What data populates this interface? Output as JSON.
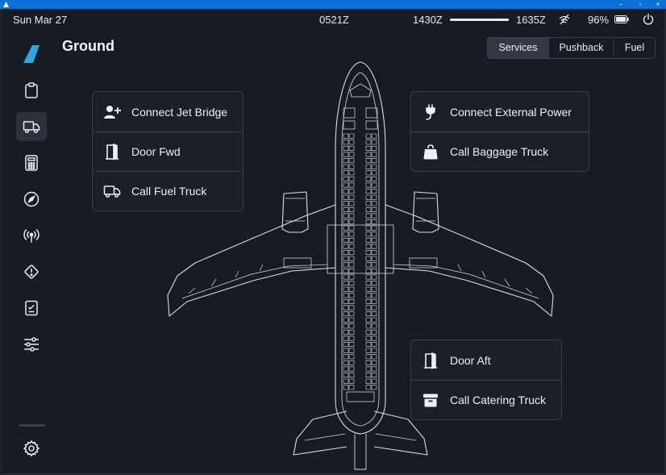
{
  "status_bar": {
    "date": "Sun Mar 27",
    "zulu_time": "0521Z",
    "flight_start": "1430Z",
    "flight_end": "1635Z",
    "flight_progress_fraction": 1.0,
    "battery_percent": "96%"
  },
  "sidebar": {
    "items": [
      {
        "name": "clipboard-icon",
        "active": false
      },
      {
        "name": "truck-icon",
        "active": true
      },
      {
        "name": "calculator-icon",
        "active": false
      },
      {
        "name": "compass-icon",
        "active": false
      },
      {
        "name": "antenna-icon",
        "active": false
      },
      {
        "name": "warning-icon",
        "active": false
      },
      {
        "name": "checklist-icon",
        "active": false
      },
      {
        "name": "sliders-icon",
        "active": false
      }
    ],
    "settings_icon": "gear-icon"
  },
  "page": {
    "title": "Ground"
  },
  "tabs": [
    {
      "label": "Services",
      "active": true
    },
    {
      "label": "Pushback",
      "active": false
    },
    {
      "label": "Fuel",
      "active": false
    }
  ],
  "cards": {
    "left": [
      {
        "label": "Connect Jet Bridge",
        "icon": "user-plus-icon"
      },
      {
        "label": "Door Fwd",
        "icon": "door-icon"
      },
      {
        "label": "Call Fuel Truck",
        "icon": "truck-icon"
      }
    ],
    "right_top": [
      {
        "label": "Connect External Power",
        "icon": "plug-icon"
      },
      {
        "label": "Call Baggage Truck",
        "icon": "bag-icon"
      }
    ],
    "right_bottom": [
      {
        "label": "Door Aft",
        "icon": "door-icon"
      },
      {
        "label": "Call Catering Truck",
        "icon": "box-icon"
      }
    ]
  },
  "colors": {
    "background": "#171b23",
    "accent_logo": "#2fa6e0",
    "active_tab": "#343a45",
    "border": "#3a404b"
  }
}
